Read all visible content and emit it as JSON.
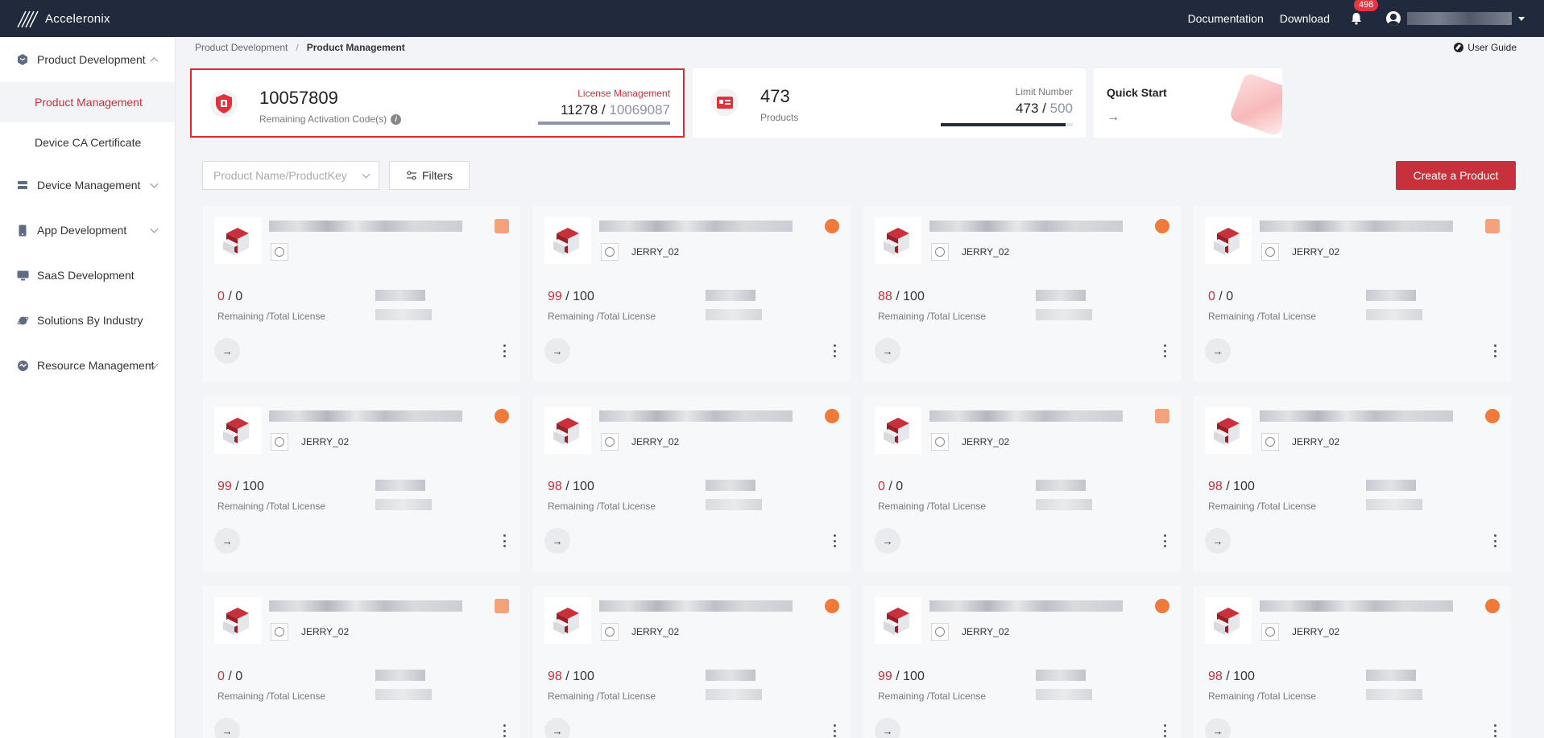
{
  "header": {
    "brand": "Acceleronix",
    "documentation": "Documentation",
    "download": "Download",
    "notification_count": "498"
  },
  "sidebar": {
    "items": [
      {
        "label": "Product Development",
        "icon": "product-dev-icon",
        "expanded": true
      },
      {
        "label": "Device Management",
        "icon": "device-mgmt-icon"
      },
      {
        "label": "App Development",
        "icon": "phone-icon"
      },
      {
        "label": "SaaS Development",
        "icon": "monitor-icon"
      },
      {
        "label": "Solutions By Industry",
        "icon": "planet-icon"
      },
      {
        "label": "Resource Management",
        "icon": "resource-icon"
      }
    ],
    "sub_items": [
      {
        "label": "Product Management",
        "active": true
      },
      {
        "label": "Device CA Certificate"
      }
    ]
  },
  "breadcrumb": {
    "parent": "Product Development",
    "separator": "/",
    "current": "Product Management"
  },
  "user_guide": "User Guide",
  "stats": {
    "activation": {
      "value": "10057809",
      "label": "Remaining Activation Code(s)",
      "right_label": "License Management",
      "used": "11278",
      "separator": "/",
      "total": "10069087",
      "fill_fraction": 0.999
    },
    "products": {
      "value": "473",
      "label": "Products",
      "right_label": "Limit Number",
      "used": "473",
      "separator": "/",
      "total": "500",
      "fill_fraction": 0.946
    },
    "quick_start": {
      "title": "Quick Start",
      "arrow": "→"
    }
  },
  "toolbar": {
    "search_placeholder": "Product Name/ProductKey",
    "filters_label": "Filters",
    "create_label": "Create a Product"
  },
  "card_labels": {
    "license_label": "Remaining /Total License",
    "go_arrow": "→"
  },
  "cards": [
    {
      "owner": "",
      "remaining": "0",
      "separator": "/",
      "total": "0",
      "corner": "sq"
    },
    {
      "owner": "JERRY_02",
      "remaining": "99",
      "separator": "/",
      "total": "100",
      "corner": "round"
    },
    {
      "owner": "JERRY_02",
      "remaining": "88",
      "separator": "/",
      "total": "100",
      "corner": "round"
    },
    {
      "owner": "JERRY_02",
      "remaining": "0",
      "separator": "/",
      "total": "0",
      "corner": "sq"
    },
    {
      "owner": "JERRY_02",
      "remaining": "99",
      "separator": "/",
      "total": "100",
      "corner": "round"
    },
    {
      "owner": "JERRY_02",
      "remaining": "98",
      "separator": "/",
      "total": "100",
      "corner": "round"
    },
    {
      "owner": "JERRY_02",
      "remaining": "0",
      "separator": "/",
      "total": "0",
      "corner": "sq"
    },
    {
      "owner": "JERRY_02",
      "remaining": "98",
      "separator": "/",
      "total": "100",
      "corner": "round"
    },
    {
      "owner": "JERRY_02",
      "remaining": "0",
      "separator": "/",
      "total": "0",
      "corner": "sq"
    },
    {
      "owner": "JERRY_02",
      "remaining": "98",
      "separator": "/",
      "total": "100",
      "corner": "round"
    },
    {
      "owner": "JERRY_02",
      "remaining": "99",
      "separator": "/",
      "total": "100",
      "corner": "round"
    },
    {
      "owner": "JERRY_02",
      "remaining": "98",
      "separator": "/",
      "total": "100",
      "corner": "round"
    }
  ],
  "colors": {
    "topbar": "#212a3c",
    "accent": "#c8303b",
    "highlight_border": "#e3262e"
  }
}
